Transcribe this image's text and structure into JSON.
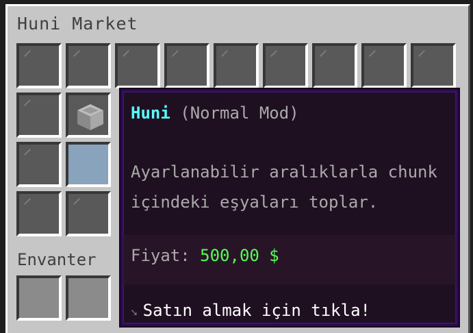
{
  "window": {
    "title": "Huni Market",
    "inventory_title": "Envanter"
  },
  "tooltip": {
    "name": "Huni",
    "mode": "(Normal Mod)",
    "description_line1": "Ayarlanabilir aralıklarla chunk",
    "description_line2": "içindeki eşyaları toplar.",
    "price_label": "Fiyat:",
    "price_value": "500,00 $",
    "action": "Satın almak için tıkla!",
    "action_icon": "arrow-icon"
  },
  "colors": {
    "name": "#55ffff",
    "price": "#55ff55",
    "text": "#aaaaaa",
    "tooltip_bg": "#160618",
    "tooltip_border": "#3a1370"
  },
  "slots": {
    "highlighted": "hopper-slot",
    "selected": "selected-slot"
  }
}
